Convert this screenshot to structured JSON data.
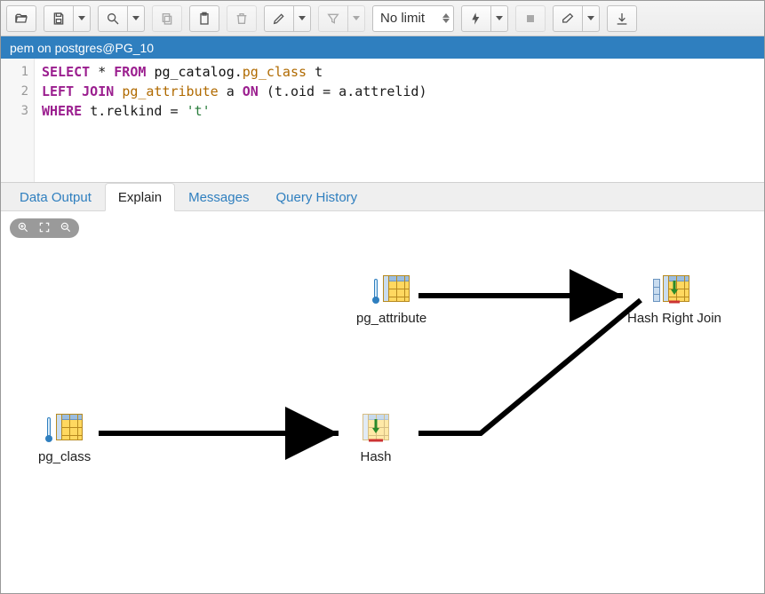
{
  "toolbar": {
    "limit_label": "No limit"
  },
  "connection": {
    "label": "pem on postgres@PG_10"
  },
  "editor": {
    "lines": [
      "1",
      "2",
      "3"
    ],
    "sql": {
      "select": "SELECT",
      "star": "*",
      "from": "FROM",
      "schema": "pg_catalog",
      "table": "pg_class",
      "alias1": "t",
      "leftjoin": "LEFT JOIN",
      "table2": "pg_attribute",
      "alias2": "a",
      "on": "ON",
      "lpar": "(",
      "rpar": ")",
      "lhs_t": "t",
      "lhs_col": "oid",
      "eq": "=",
      "rhs_a": "a",
      "rhs_col": "attrelid",
      "where": "WHERE",
      "w_t": "t",
      "w_col": "relkind",
      "w_eq": "=",
      "w_val": "'t'"
    }
  },
  "tabs": {
    "data_output": "Data Output",
    "explain": "Explain",
    "messages": "Messages",
    "history": "Query History"
  },
  "explain": {
    "nodes": {
      "pg_attribute": "pg_attribute",
      "hash_right_join": "Hash Right Join",
      "pg_class": "pg_class",
      "hash": "Hash"
    }
  }
}
